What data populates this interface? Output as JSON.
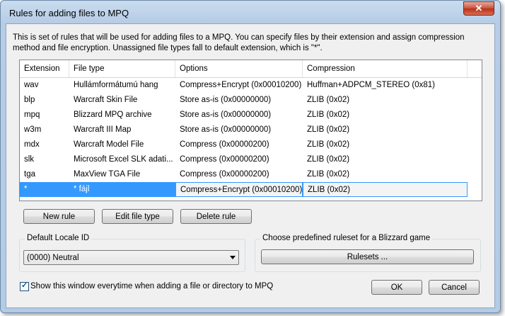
{
  "window": {
    "title": "Rules for adding files to MPQ",
    "close_label": "✕"
  },
  "description": "This is set of rules that will be used for adding files to a MPQ. You can specify files by their extension and assign compression method and file encryption. Unassigned file types fall to default extension, which is \"*\".",
  "table": {
    "columns": [
      "Extension",
      "File type",
      "Options",
      "Compression"
    ],
    "rows": [
      [
        "wav",
        "Hullámformátumú hang",
        "Compress+Encrypt (0x00010200)",
        "Huffman+ADPCM_STEREO (0x81)"
      ],
      [
        "blp",
        "Warcraft Skin File",
        "Store as-is (0x00000000)",
        "ZLIB (0x02)"
      ],
      [
        "mpq",
        "Blizzard MPQ archive",
        "Store as-is (0x00000000)",
        "ZLIB (0x02)"
      ],
      [
        "w3m",
        "Warcraft III Map",
        "Store as-is (0x00000000)",
        "ZLIB (0x02)"
      ],
      [
        "mdx",
        "Warcraft Model File",
        "Compress (0x00000200)",
        "ZLIB (0x02)"
      ],
      [
        "slk",
        "Microsoft Excel SLK adati...",
        "Compress (0x00000200)",
        "ZLIB (0x02)"
      ],
      [
        "tga",
        "MaxView TGA File",
        "Compress (0x00000200)",
        "ZLIB (0x02)"
      ],
      [
        "*",
        "* fájl",
        "Compress+Encrypt (0x00010200)",
        "ZLIB (0x02)"
      ]
    ],
    "selected_index": 7
  },
  "buttons": {
    "new_rule": "New rule",
    "edit_file_type": "Edit file type",
    "delete_rule": "Delete rule",
    "ok": "OK",
    "cancel": "Cancel",
    "rulesets": "Rulesets ..."
  },
  "locale_group": {
    "label": "Default Locale ID",
    "value": "(0000) Neutral"
  },
  "ruleset_group": {
    "label": "Choose predefined ruleset for a Blizzard game"
  },
  "show_checkbox": {
    "label": "Show this window everytime when adding a file or directory to MPQ",
    "checked": true
  }
}
